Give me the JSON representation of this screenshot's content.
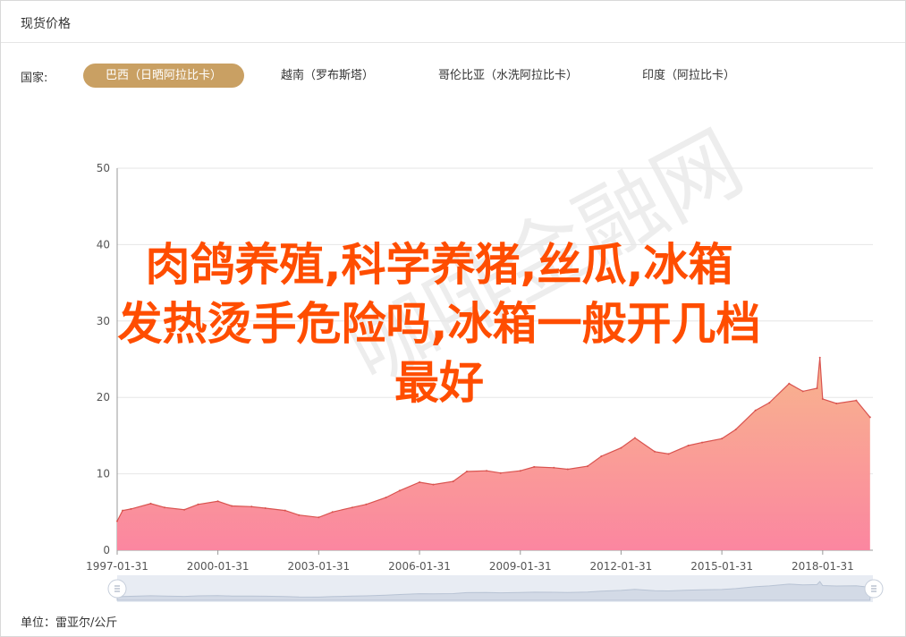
{
  "panel": {
    "title": "现货价格"
  },
  "filter": {
    "label": "国家:",
    "tabs": [
      {
        "label": "巴西（日晒阿拉比卡）",
        "active": true
      },
      {
        "label": "越南（罗布斯塔）",
        "active": false
      },
      {
        "label": "哥伦比亚（水洗阿拉比卡）",
        "active": false
      },
      {
        "label": "印度（阿拉比卡）",
        "active": false
      }
    ]
  },
  "overlay": {
    "line1": "肉鸽养殖,科学养猪,丝瓜,冰箱",
    "line2": "发热烫手危险吗,冰箱一般开几档",
    "line3": "最好"
  },
  "watermark": "咖啡金融网",
  "unit": "单位：雷亚尔/公斤",
  "colors": {
    "accent": "#c9a063",
    "series_line": "#d9534f",
    "area_top": "#f8b58d",
    "area_bottom": "#fb86a0",
    "overlay_text": "#ff4d00"
  },
  "chart_data": {
    "type": "area",
    "title": "",
    "xlabel": "",
    "ylabel": "",
    "ylim": [
      0,
      50
    ],
    "yticks": [
      "0",
      "10",
      "20",
      "30",
      "40",
      "50"
    ],
    "xticks": [
      "1997-01-31",
      "2000-01-31",
      "2003-01-31",
      "2006-01-31",
      "2009-01-31",
      "2012-01-31",
      "2015-01-31",
      "2018-01-31"
    ],
    "grid": true,
    "series": [
      {
        "x": [
          "1997-01-31",
          "1997-03-31",
          "1997-06-30",
          "1998-01-31",
          "1998-06-30",
          "1999-01-31",
          "1999-06-30",
          "2000-01-31",
          "2000-06-30",
          "2001-01-31",
          "2001-06-30",
          "2002-01-31",
          "2002-06-30",
          "2003-01-31",
          "2003-06-30",
          "2004-01-31",
          "2004-06-30",
          "2005-01-31",
          "2005-06-30",
          "2006-01-31",
          "2006-06-30",
          "2007-01-31",
          "2007-06-30",
          "2008-01-31",
          "2008-06-30",
          "2009-01-31",
          "2009-06-30",
          "2010-01-31",
          "2010-06-30",
          "2011-01-31",
          "2011-06-30",
          "2012-01-31",
          "2012-06-30",
          "2013-01-31",
          "2013-06-30",
          "2014-01-31",
          "2014-06-30",
          "2015-01-31",
          "2015-06-30",
          "2016-01-31",
          "2016-06-30",
          "2017-01-31",
          "2017-06-30",
          "2017-11-30",
          "2017-12-31",
          "2018-01-31",
          "2018-06-30",
          "2019-01-31",
          "2019-06-30"
        ],
        "values": [
          3.8,
          5.2,
          5.4,
          6.1,
          5.6,
          5.3,
          6.0,
          6.4,
          5.8,
          5.7,
          5.5,
          5.2,
          4.6,
          4.3,
          5.0,
          5.6,
          6.0,
          6.9,
          7.8,
          8.9,
          8.6,
          9.0,
          10.3,
          10.4,
          10.1,
          10.4,
          10.9,
          10.8,
          10.6,
          11.0,
          12.3,
          13.4,
          14.7,
          12.9,
          12.6,
          13.7,
          14.1,
          14.6,
          15.8,
          18.3,
          19.3,
          21.8,
          20.8,
          21.2,
          25.2,
          19.8,
          19.2,
          19.6,
          17.4
        ]
      }
    ]
  }
}
